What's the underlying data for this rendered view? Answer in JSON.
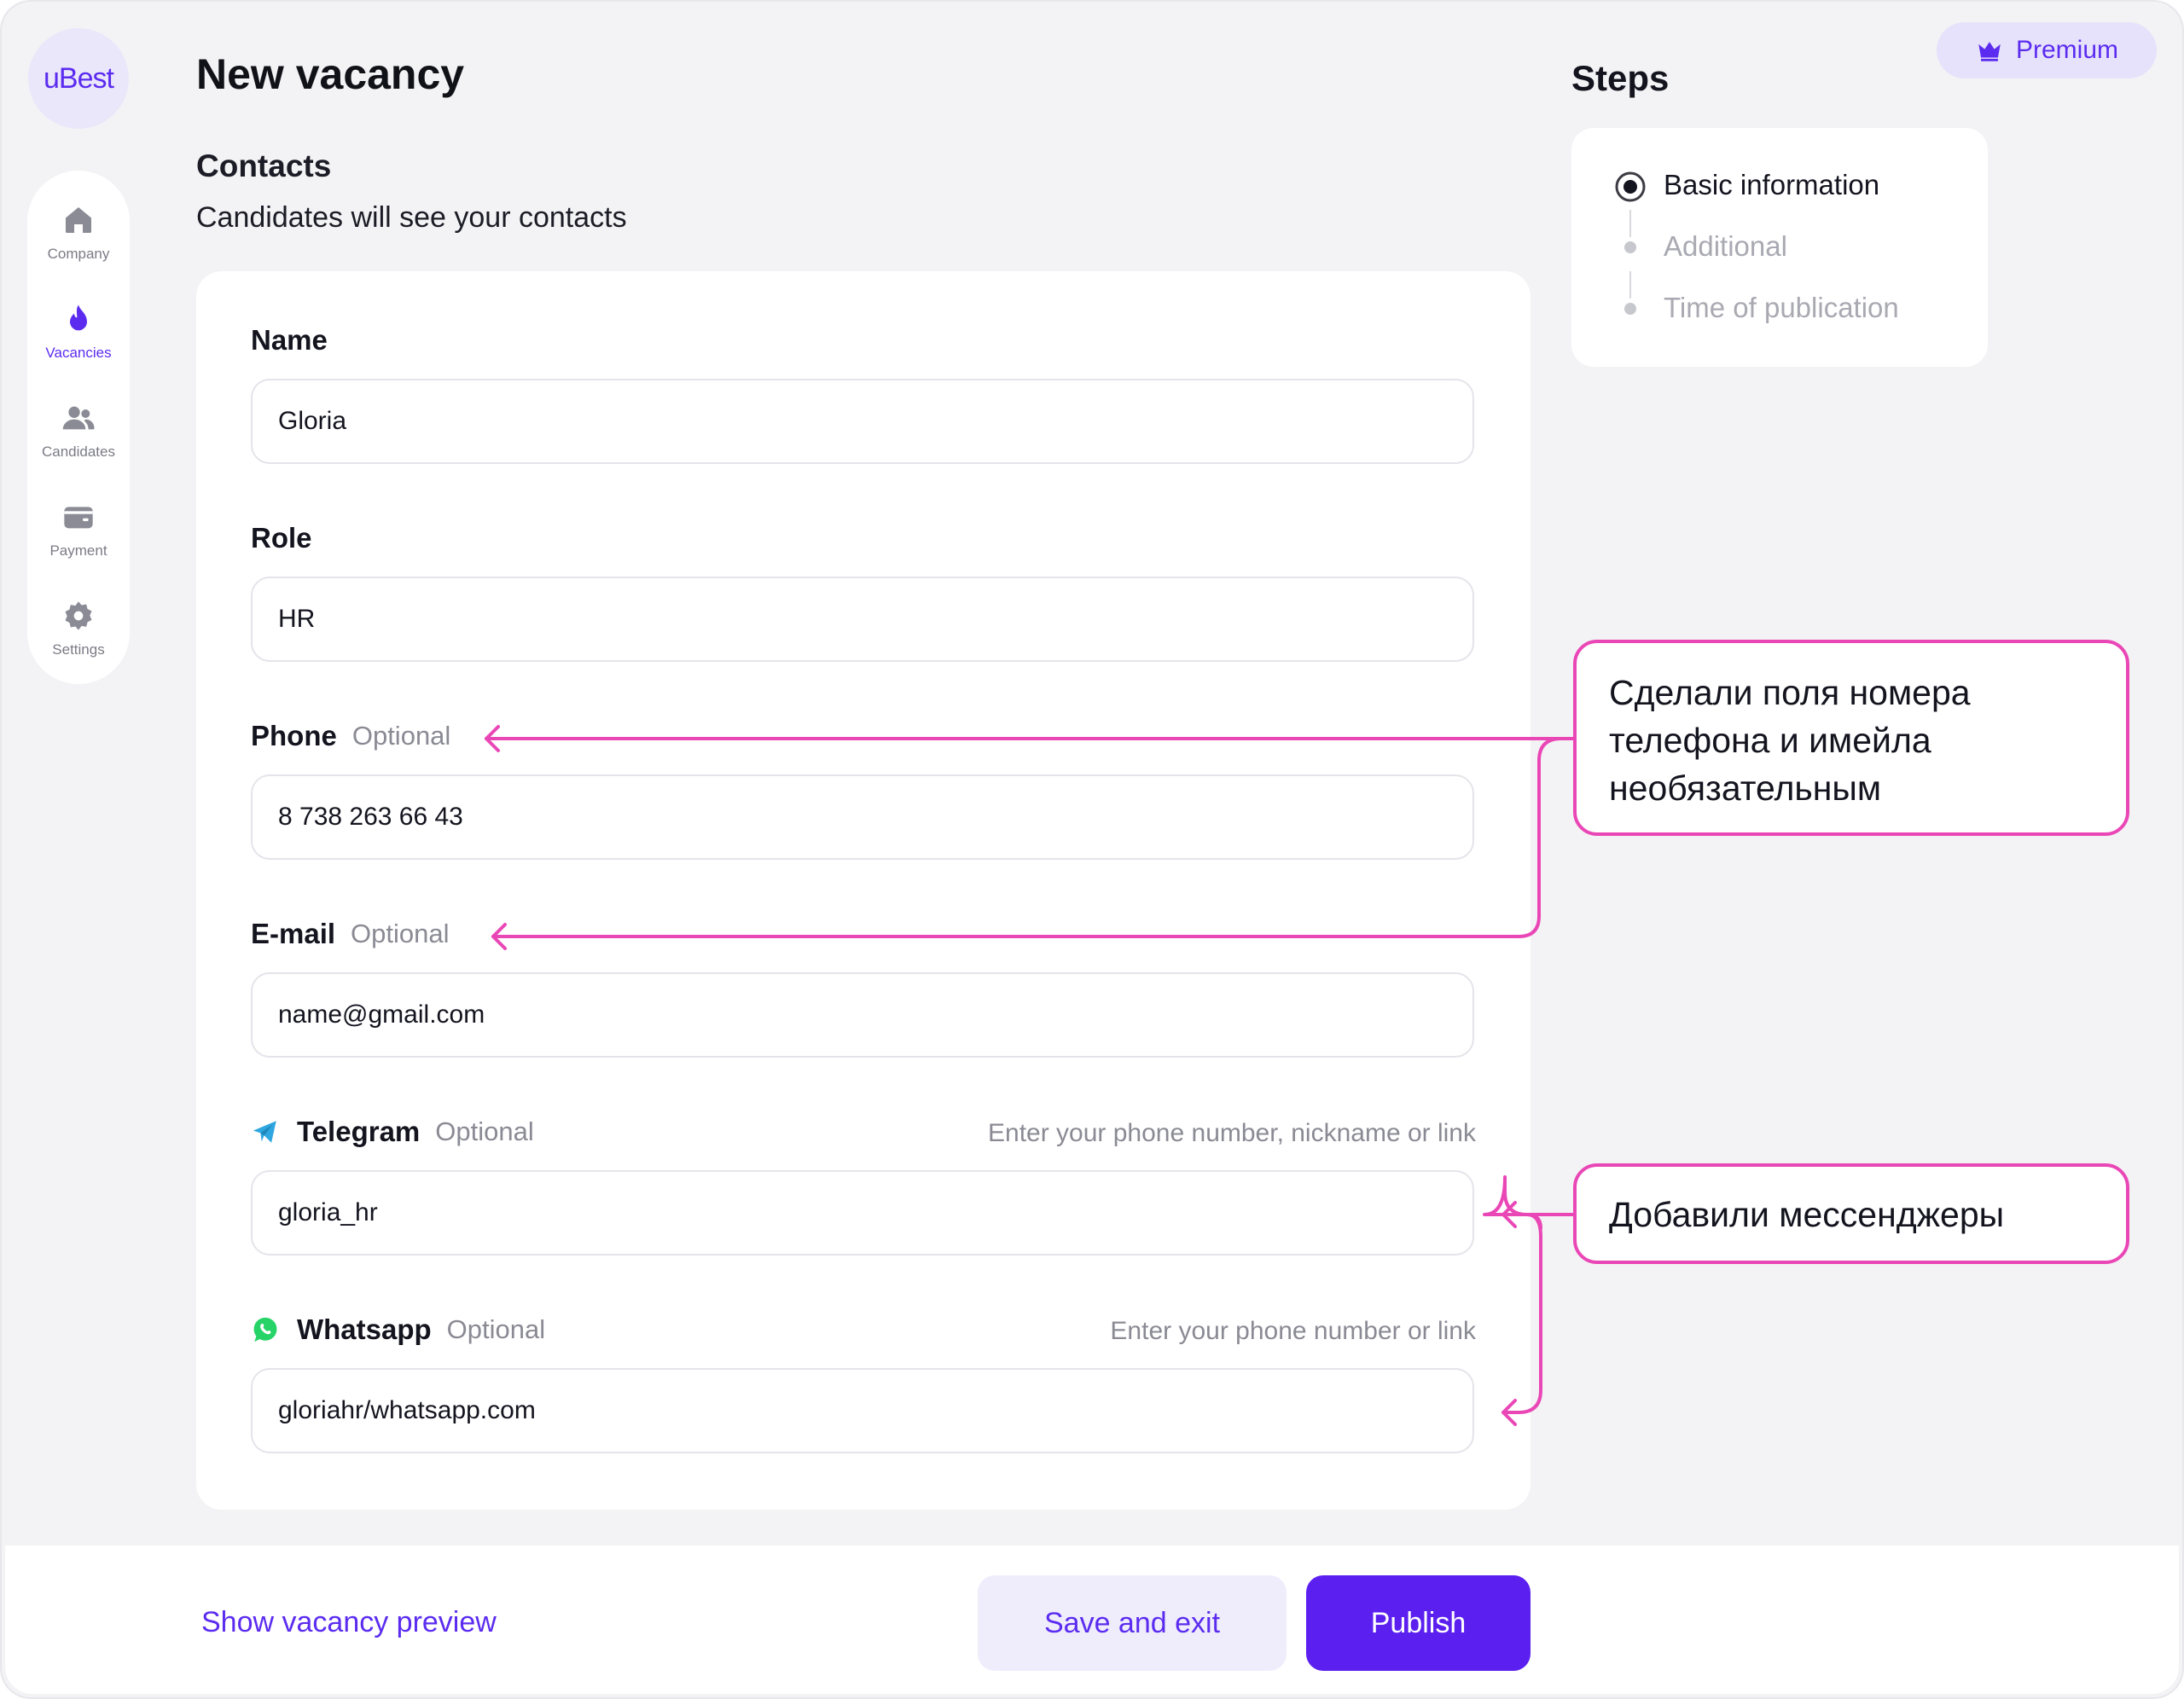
{
  "app": {
    "logo_text": "uBest"
  },
  "sidebar": {
    "items": [
      {
        "label": "Company",
        "icon": "home-icon"
      },
      {
        "label": "Vacancies",
        "icon": "flame-icon"
      },
      {
        "label": "Candidates",
        "icon": "users-icon"
      },
      {
        "label": "Payment",
        "icon": "wallet-icon"
      },
      {
        "label": "Settings",
        "icon": "gear-icon"
      }
    ],
    "active_index": 1
  },
  "header": {
    "title": "New vacancy",
    "premium_label": "Premium"
  },
  "section": {
    "title": "Contacts",
    "subtitle": "Candidates will see your contacts"
  },
  "form": {
    "optional_label": "Optional",
    "name": {
      "label": "Name",
      "value": "Gloria"
    },
    "role": {
      "label": "Role",
      "value": "HR"
    },
    "phone": {
      "label": "Phone",
      "value": "8 738 263 66 43"
    },
    "email": {
      "label": "E-mail",
      "value": "name@gmail.com"
    },
    "telegram": {
      "label": "Telegram",
      "hint": "Enter your phone number, nickname or link",
      "value": "gloria_hr",
      "icon": "telegram-icon"
    },
    "whatsapp": {
      "label": "Whatsapp",
      "hint": "Enter your phone number or link",
      "value": "gloriahr/whatsapp.com",
      "icon": "whatsapp-icon"
    }
  },
  "steps": {
    "title": "Steps",
    "items": [
      {
        "label": "Basic information",
        "state": "active"
      },
      {
        "label": "Additional",
        "state": "inactive"
      },
      {
        "label": "Time of publication",
        "state": "inactive"
      }
    ]
  },
  "annotations": [
    {
      "text": "Сделали поля номера телефона и имейла необязательным"
    },
    {
      "text": "Добавили мессенджеры"
    }
  ],
  "footer": {
    "preview_label": "Show vacancy preview",
    "save_label": "Save and exit",
    "publish_label": "Publish"
  },
  "colors": {
    "accent": "#5b1ff0",
    "annotation": "#ea47b6",
    "background": "#f3f3f5"
  }
}
